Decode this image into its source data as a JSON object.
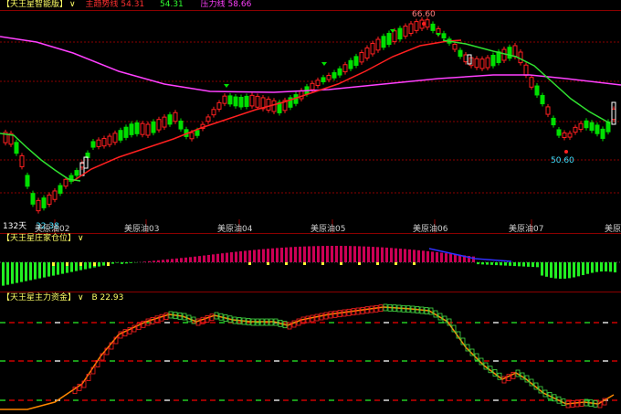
{
  "panel1": {
    "title": "【天王星智能版】",
    "dropdown": "∨",
    "line1_label": "主趋势线",
    "line1_value": "54.31",
    "line2_value": "54.31",
    "line3_label": "压力线",
    "line3_value": "58.66",
    "high_label": "66.60",
    "low_label": "50.60",
    "left_low_label": "32.38",
    "days_label": "132天"
  },
  "axis": {
    "x_ticks": [
      "美原油02",
      "美原油03",
      "美原油04",
      "美原油05",
      "美原油06",
      "美原油07",
      "美原"
    ]
  },
  "panel2": {
    "title": "【天王星庄家仓位】",
    "dropdown": "∨"
  },
  "panel3": {
    "title": "【天王星主力资金】",
    "dropdown": "∨",
    "value_label": "B",
    "value": "22.93"
  },
  "colors": {
    "up": "#ff2020",
    "down": "#00e000",
    "ma_red": "#ff2020",
    "ma_green": "#30e030",
    "pressure": "#ff40ff",
    "grid": "#8b0000",
    "hist_green": "#22ee22",
    "hist_yellow": "#ffff33",
    "hist_magenta": "#cc0055"
  }
}
